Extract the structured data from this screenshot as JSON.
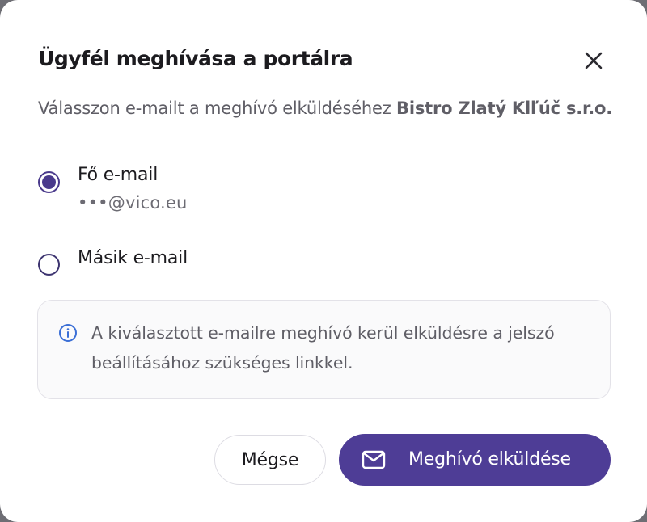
{
  "dialog": {
    "title": "Ügyfél meghívása a portálra",
    "subtitle_prefix": "Válasszon e-mailt a meghívó elküldéséhez ",
    "subtitle_company": "Bistro Zlatý Klľúč s.r.o.",
    "close_icon": "close-icon"
  },
  "options": [
    {
      "label": "Fő e-mail",
      "email": "•••@vico.eu",
      "selected": true
    },
    {
      "label": "Másik e-mail",
      "selected": false
    }
  ],
  "info": {
    "icon": "info-icon",
    "text": "A kiválasztott e-mailre meghívó kerül elküldésre a jelszó beállításához szükséges linkkel."
  },
  "actions": {
    "cancel_label": "Mégse",
    "send_label": "Meghívó elküldése",
    "send_icon": "mail-icon"
  },
  "colors": {
    "accent": "#4e3d96",
    "text_primary": "#1c1b1f",
    "text_secondary": "#5f5e66",
    "info_bg": "#fafafb"
  }
}
